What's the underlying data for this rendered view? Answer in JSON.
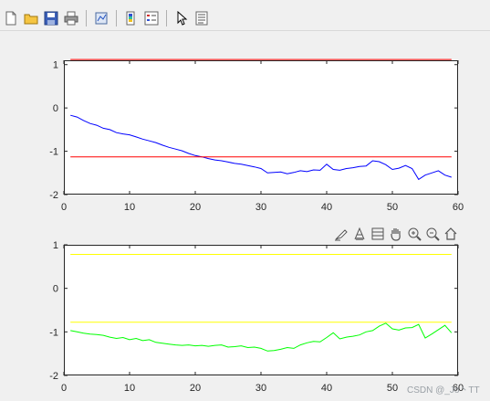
{
  "toolbar": {
    "buttons": [
      "new-file-icon",
      "open-folder-icon",
      "save-icon",
      "print-icon",
      "link-plot-icon",
      "insert-colorbar-icon",
      "insert-legend-icon",
      "select-arrow-icon",
      "property-inspector-icon"
    ]
  },
  "axes_toolbar": {
    "buttons": [
      "brush-icon",
      "data-tips-icon",
      "rotate-icon",
      "pan-hand-icon",
      "zoom-in-icon",
      "zoom-out-icon",
      "home-icon"
    ]
  },
  "watermark": "CSDN @_Jo丶TT",
  "chart_data": [
    {
      "type": "line",
      "xlim": [
        0,
        60
      ],
      "ylim": [
        -2,
        1.1
      ],
      "xticks": [
        "0",
        "10",
        "20",
        "30",
        "40",
        "50",
        "60"
      ],
      "yticks": [
        "-2",
        "-1",
        "0",
        "1"
      ],
      "xtick_values": [
        0,
        10,
        20,
        30,
        40,
        50,
        60
      ],
      "ytick_values": [
        -2,
        -1,
        0,
        1
      ],
      "series": [
        {
          "color": "#0000ff",
          "x": [
            1,
            2,
            3,
            4,
            5,
            6,
            7,
            8,
            9,
            10,
            11,
            12,
            13,
            14,
            15,
            16,
            17,
            18,
            19,
            20,
            21,
            22,
            23,
            24,
            25,
            26,
            27,
            28,
            29,
            30,
            31,
            32,
            33,
            34,
            35,
            36,
            37,
            38,
            39,
            40,
            41,
            42,
            43,
            44,
            45,
            46,
            47,
            48,
            49,
            50,
            51,
            52,
            53,
            54,
            55,
            56,
            57,
            58,
            59
          ],
          "y": [
            -0.17,
            -0.21,
            -0.29,
            -0.36,
            -0.4,
            -0.47,
            -0.5,
            -0.57,
            -0.6,
            -0.62,
            -0.67,
            -0.72,
            -0.76,
            -0.8,
            -0.86,
            -0.91,
            -0.95,
            -0.99,
            -1.05,
            -1.1,
            -1.13,
            -1.17,
            -1.2,
            -1.22,
            -1.25,
            -1.28,
            -1.3,
            -1.33,
            -1.36,
            -1.4,
            -1.5,
            -1.49,
            -1.48,
            -1.52,
            -1.49,
            -1.45,
            -1.47,
            -1.43,
            -1.44,
            -1.3,
            -1.42,
            -1.44,
            -1.4,
            -1.38,
            -1.35,
            -1.34,
            -1.22,
            -1.24,
            -1.31,
            -1.42,
            -1.39,
            -1.33,
            -1.4,
            -1.65,
            -1.55,
            -1.5,
            -1.45,
            -1.55,
            -1.6
          ]
        },
        {
          "color": "#ff0000",
          "x": [
            1,
            59
          ],
          "y": [
            -1.13,
            -1.13
          ]
        },
        {
          "color": "#ff0000",
          "x": [
            1,
            59
          ],
          "y": [
            1.12,
            1.12
          ]
        }
      ]
    },
    {
      "type": "line",
      "xlim": [
        0,
        60
      ],
      "ylim": [
        -2,
        1
      ],
      "xticks": [
        "0",
        "10",
        "20",
        "30",
        "40",
        "50",
        "60"
      ],
      "yticks": [
        "-2",
        "-1",
        "0",
        "1"
      ],
      "xtick_values": [
        0,
        10,
        20,
        30,
        40,
        50,
        60
      ],
      "ytick_values": [
        -2,
        -1,
        0,
        1
      ],
      "series": [
        {
          "color": "#00ff00",
          "x": [
            1,
            2,
            3,
            4,
            5,
            6,
            7,
            8,
            9,
            10,
            11,
            12,
            13,
            14,
            15,
            16,
            17,
            18,
            19,
            20,
            21,
            22,
            23,
            24,
            25,
            26,
            27,
            28,
            29,
            30,
            31,
            32,
            33,
            34,
            35,
            36,
            37,
            38,
            39,
            40,
            41,
            42,
            43,
            44,
            45,
            46,
            47,
            48,
            49,
            50,
            51,
            52,
            53,
            54,
            55,
            56,
            57,
            58,
            59
          ],
          "y": [
            -0.97,
            -1.0,
            -1.03,
            -1.05,
            -1.06,
            -1.08,
            -1.12,
            -1.15,
            -1.13,
            -1.18,
            -1.15,
            -1.2,
            -1.18,
            -1.24,
            -1.26,
            -1.28,
            -1.3,
            -1.31,
            -1.3,
            -1.32,
            -1.31,
            -1.33,
            -1.31,
            -1.3,
            -1.35,
            -1.34,
            -1.32,
            -1.36,
            -1.35,
            -1.38,
            -1.44,
            -1.43,
            -1.4,
            -1.36,
            -1.38,
            -1.3,
            -1.25,
            -1.22,
            -1.23,
            -1.13,
            -1.02,
            -1.16,
            -1.12,
            -1.1,
            -1.07,
            -1.0,
            -0.97,
            -0.87,
            -0.8,
            -0.93,
            -0.96,
            -0.91,
            -0.9,
            -0.83,
            -1.14,
            -1.05,
            -0.95,
            -0.85,
            -1.02
          ]
        },
        {
          "color": "#ffff00",
          "x": [
            1,
            59
          ],
          "y": [
            -0.78,
            -0.78
          ]
        },
        {
          "color": "#ffff00",
          "x": [
            1,
            59
          ],
          "y": [
            0.78,
            0.78
          ]
        }
      ]
    }
  ]
}
